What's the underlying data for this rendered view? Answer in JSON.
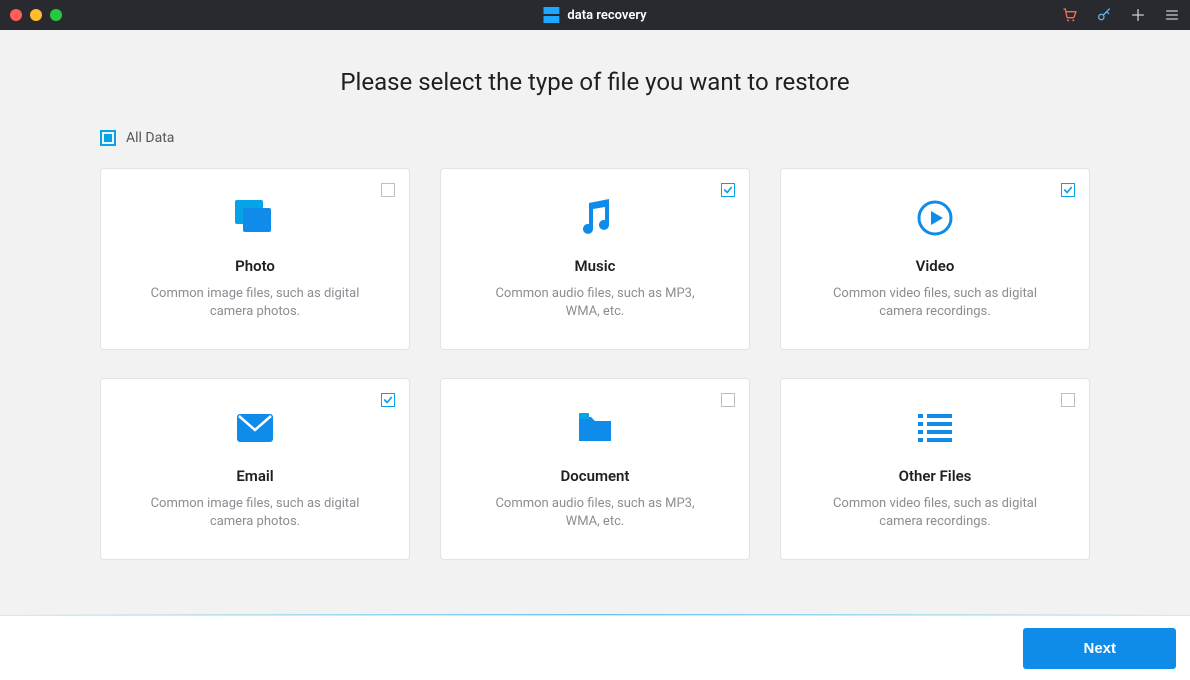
{
  "app": {
    "name": "data recovery"
  },
  "titlebar": {
    "icons": [
      "cart",
      "key",
      "plus",
      "menu"
    ]
  },
  "page": {
    "title": "Please select the type of file you want to restore",
    "all_data_label": "All Data"
  },
  "cards": [
    {
      "id": "photo",
      "title": "Photo",
      "desc": "Common image files, such as digital camera photos.",
      "checked": false,
      "icon": "photo"
    },
    {
      "id": "music",
      "title": "Music",
      "desc": "Common audio files, such as MP3, WMA, etc.",
      "checked": true,
      "icon": "music"
    },
    {
      "id": "video",
      "title": "Video",
      "desc": "Common video files, such as digital camera recordings.",
      "checked": true,
      "icon": "video"
    },
    {
      "id": "email",
      "title": "Email",
      "desc": "Common image files, such as digital camera photos.",
      "checked": true,
      "icon": "email"
    },
    {
      "id": "document",
      "title": "Document",
      "desc": "Common audio files, such as MP3, WMA, etc.",
      "checked": false,
      "icon": "document"
    },
    {
      "id": "other",
      "title": "Other Files",
      "desc": "Common video files, such as digital camera recordings.",
      "checked": false,
      "icon": "other"
    }
  ],
  "footer": {
    "next_label": "Next"
  },
  "colors": {
    "accent": "#06a3e8",
    "primary_btn": "#0f8ce9"
  }
}
